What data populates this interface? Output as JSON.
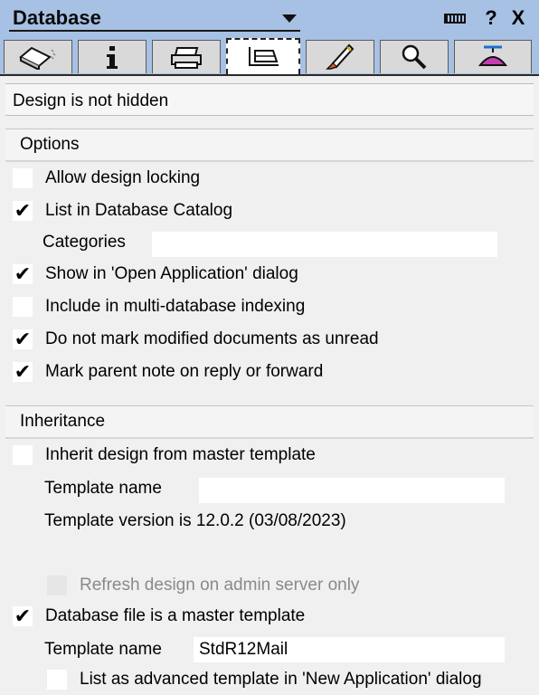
{
  "titlebar": {
    "title": "Database",
    "pin_icon": "pin-icon",
    "help_label": "?",
    "close_label": "X"
  },
  "tabs": [
    {
      "name": "basics-tab",
      "icon": "eraser-icon"
    },
    {
      "name": "info-tab",
      "icon": "info-icon"
    },
    {
      "name": "printing-tab",
      "icon": "printer-icon"
    },
    {
      "name": "design-tab",
      "icon": "design-icon",
      "active": true
    },
    {
      "name": "launch-tab",
      "icon": "rocket-icon"
    },
    {
      "name": "fulltext-tab",
      "icon": "magnifier-icon"
    },
    {
      "name": "advanced-tab",
      "icon": "propeller-hat-icon"
    }
  ],
  "status": {
    "text": "Design is not hidden"
  },
  "options": {
    "title": "Options",
    "allow_locking": {
      "label": "Allow design locking",
      "checked": false
    },
    "list_catalog": {
      "label": "List in Database Catalog",
      "checked": true
    },
    "categories": {
      "label": "Categories",
      "value": ""
    },
    "show_open_app": {
      "label": "Show in 'Open Application' dialog",
      "checked": true
    },
    "multi_db_index": {
      "label": "Include in multi-database indexing",
      "checked": false
    },
    "no_mark_unread": {
      "label": "Do not mark modified documents as unread",
      "checked": true
    },
    "mark_parent": {
      "label": "Mark parent note on reply or forward",
      "checked": true
    }
  },
  "inheritance": {
    "title": "Inheritance",
    "inherit_master": {
      "label": "Inherit design from master template",
      "checked": false
    },
    "template_name_1": {
      "label": "Template name",
      "value": ""
    },
    "template_version": "Template version is 12.0.2 (03/08/2023)",
    "refresh_admin": {
      "label": "Refresh design on admin server only",
      "checked": false,
      "disabled": true
    },
    "is_master": {
      "label": "Database file is a master template",
      "checked": true
    },
    "template_name_2": {
      "label": "Template name",
      "value": "StdR12Mail"
    },
    "list_advanced": {
      "label": "List as advanced template in 'New Application' dialog",
      "checked": false
    }
  },
  "check_glyph": "✔"
}
